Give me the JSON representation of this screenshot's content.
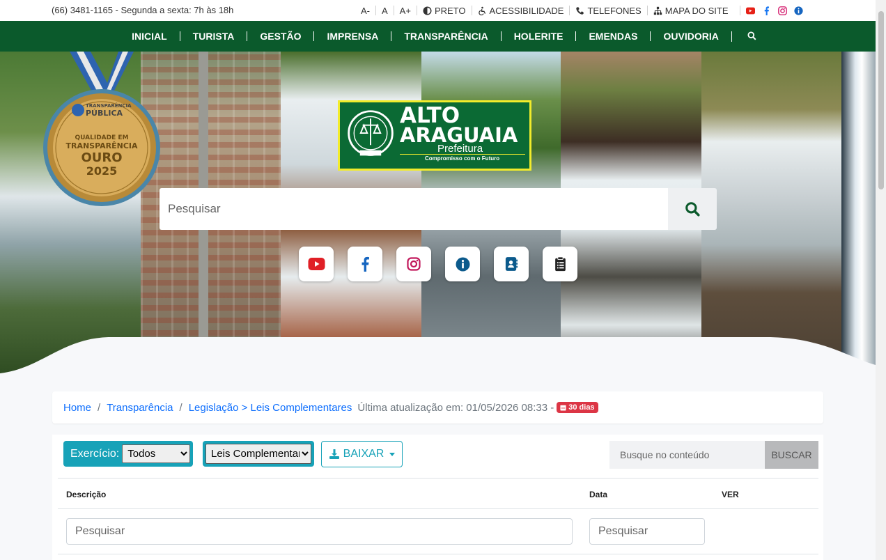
{
  "topbar": {
    "phone": "(66) 3481-1165 - Segunda a sexta: 7h às 18h",
    "font_smaller": "A-",
    "font_normal": "A",
    "font_larger": "A+",
    "contrast": "PRETO",
    "accessibility": "ACESSIBILIDADE",
    "phones": "TELEFONES",
    "sitemap": "MAPA DO SITE",
    "social": [
      "youtube-icon",
      "facebook-icon",
      "instagram-icon",
      "info-icon"
    ]
  },
  "nav": {
    "items": [
      "INICIAL",
      "TURISTA",
      "GESTÃO",
      "IMPRENSA",
      "TRANSPARÊNCIA",
      "HOLERITE",
      "EMENDAS",
      "OUVIDORIA"
    ]
  },
  "hero": {
    "logo_line1": "ALTO",
    "logo_line2": "ARAGUAIA",
    "logo_sub": "Prefeitura",
    "logo_slogan": "Compromisso com o Futuro",
    "medal_line1": "TRANSPARÊNCIA",
    "medal_line2": "PÚBLICA",
    "medal_line3": "QUALIDADE EM",
    "medal_line4": "TRANSPARÊNCIA",
    "medal_line5": "OURO",
    "medal_line6": "2025",
    "search_placeholder": "Pesquisar",
    "quick_icons": [
      "youtube-icon",
      "facebook-icon",
      "instagram-icon",
      "info-icon",
      "contacts-icon",
      "clipboard-icon"
    ]
  },
  "breadcrumb": {
    "home": "Home",
    "transparencia": "Transparência",
    "current": "Legislação > Leis Complementares",
    "updated": "Última atualização em: 01/05/2026 08:33 -",
    "badge": "30 dias"
  },
  "filters": {
    "exercicio_label": "Exercício:",
    "exercicio_value": "Todos",
    "tipo_value": "Leis Complementares",
    "baixar": "BAIXAR",
    "search_placeholder": "Busque no conteúdo",
    "search_button": "BUSCAR"
  },
  "table": {
    "headers": [
      "Descrição",
      "Data",
      "VER"
    ],
    "desc_placeholder": "Pesquisar",
    "date_placeholder": "Pesquisar"
  },
  "colors": {
    "nav_green": "#0b5a2c",
    "teal": "#17a2b8",
    "link_blue": "#0d6efd",
    "badge_red": "#dc3545",
    "logo_yellow": "#f2ec2b"
  }
}
